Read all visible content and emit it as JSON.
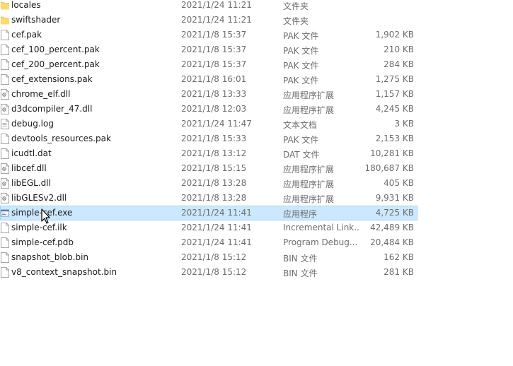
{
  "files": [
    {
      "name": "locales",
      "date": "2021/1/24 11:21",
      "type": "文件夹",
      "size": "",
      "icon": "folder-icon"
    },
    {
      "name": "swiftshader",
      "date": "2021/1/24 11:21",
      "type": "文件夹",
      "size": "",
      "icon": "folder-icon"
    },
    {
      "name": "cef.pak",
      "date": "2021/1/8 15:37",
      "type": "PAK 文件",
      "size": "1,902 KB",
      "icon": "file-icon"
    },
    {
      "name": "cef_100_percent.pak",
      "date": "2021/1/8 15:37",
      "type": "PAK 文件",
      "size": "210 KB",
      "icon": "file-icon"
    },
    {
      "name": "cef_200_percent.pak",
      "date": "2021/1/8 15:37",
      "type": "PAK 文件",
      "size": "284 KB",
      "icon": "file-icon"
    },
    {
      "name": "cef_extensions.pak",
      "date": "2021/1/8 16:01",
      "type": "PAK 文件",
      "size": "1,275 KB",
      "icon": "file-icon"
    },
    {
      "name": "chrome_elf.dll",
      "date": "2021/1/8 13:33",
      "type": "应用程序扩展",
      "size": "1,157 KB",
      "icon": "dll-icon"
    },
    {
      "name": "d3dcompiler_47.dll",
      "date": "2021/1/8 12:03",
      "type": "应用程序扩展",
      "size": "4,245 KB",
      "icon": "dll-icon"
    },
    {
      "name": "debug.log",
      "date": "2021/1/24 11:47",
      "type": "文本文档",
      "size": "3 KB",
      "icon": "text-file-icon"
    },
    {
      "name": "devtools_resources.pak",
      "date": "2021/1/8 15:33",
      "type": "PAK 文件",
      "size": "2,153 KB",
      "icon": "file-icon"
    },
    {
      "name": "icudtl.dat",
      "date": "2021/1/8 13:12",
      "type": "DAT 文件",
      "size": "10,281 KB",
      "icon": "file-icon"
    },
    {
      "name": "libcef.dll",
      "date": "2021/1/8 15:15",
      "type": "应用程序扩展",
      "size": "180,687 KB",
      "icon": "dll-icon"
    },
    {
      "name": "libEGL.dll",
      "date": "2021/1/8 13:28",
      "type": "应用程序扩展",
      "size": "405 KB",
      "icon": "dll-icon"
    },
    {
      "name": "libGLESv2.dll",
      "date": "2021/1/8 13:28",
      "type": "应用程序扩展",
      "size": "9,931 KB",
      "icon": "dll-icon"
    },
    {
      "name": "simple-cef.exe",
      "date": "2021/1/24 11:41",
      "type": "应用程序",
      "size": "4,725 KB",
      "icon": "exe-icon",
      "selected": true
    },
    {
      "name": "simple-cef.ilk",
      "date": "2021/1/24 11:41",
      "type": "Incremental Link...",
      "size": "42,489 KB",
      "icon": "file-icon"
    },
    {
      "name": "simple-cef.pdb",
      "date": "2021/1/24 11:41",
      "type": "Program Debug...",
      "size": "20,484 KB",
      "icon": "file-icon"
    },
    {
      "name": "snapshot_blob.bin",
      "date": "2021/1/8 15:12",
      "type": "BIN 文件",
      "size": "162 KB",
      "icon": "file-icon"
    },
    {
      "name": "v8_context_snapshot.bin",
      "date": "2021/1/8 15:12",
      "type": "BIN 文件",
      "size": "281 KB",
      "icon": "file-icon"
    }
  ],
  "colors": {
    "selection_bg": "#cce8ff",
    "selection_border": "#99d1ff",
    "folder": "#f8d775",
    "meta_text": "#6d6d6d"
  }
}
